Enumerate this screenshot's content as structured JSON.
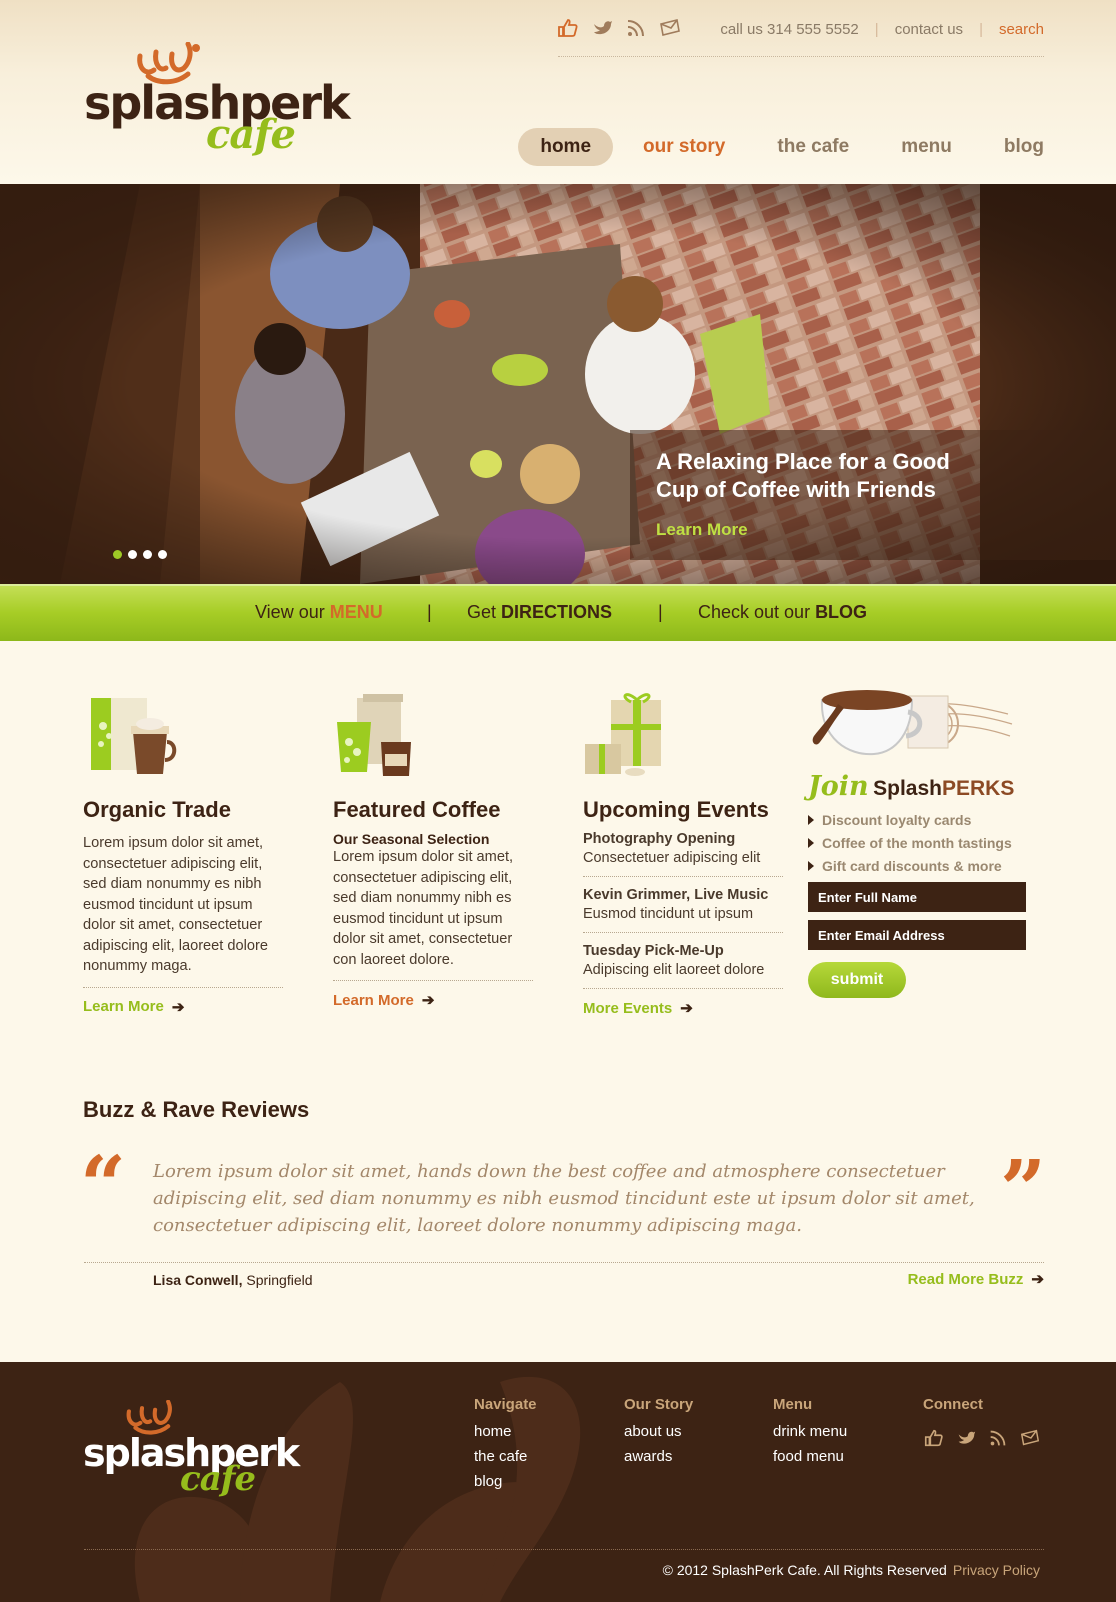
{
  "brand": {
    "name_main": "splashperk",
    "name_sub": "cafe"
  },
  "top_bar": {
    "icons": [
      "thumbs-up-icon",
      "bird-icon",
      "rss-icon",
      "mail-icon"
    ],
    "phone": "call us 314 555 5552",
    "contact": "contact us",
    "search": "search"
  },
  "nav": {
    "items": [
      {
        "label": "home",
        "active": true
      },
      {
        "label": "our story"
      },
      {
        "label": "the cafe"
      },
      {
        "label": "menu"
      },
      {
        "label": "blog"
      }
    ]
  },
  "hero": {
    "title": "A Relaxing Place for a Good Cup of Coffee with Friends",
    "learn_more": "Learn More",
    "slide_count": 4,
    "active_slide": 1
  },
  "green_bar": {
    "menu_prefix": "View our ",
    "menu_word": "MENU",
    "directions_prefix": "Get ",
    "directions_word": "DIRECTIONS",
    "blog_prefix": "Check out our ",
    "blog_word": "BLOG",
    "separator": "|"
  },
  "columns": {
    "organic": {
      "title": "Organic Trade",
      "text": "Lorem ipsum dolor sit amet, consectetuer adipiscing elit, sed diam nonummy es nibh eusmod tincidunt ut ipsum dolor sit amet, consectetuer adipiscing elit, laoreet dolore nonummy maga.",
      "link": "Learn More"
    },
    "featured": {
      "title": "Featured Coffee",
      "subtitle": "Our Seasonal Selection",
      "text": "Lorem ipsum dolor sit amet, consectetuer adipiscing elit, sed diam nonummy nibh es eusmod tincidunt ut ipsum dolor sit amet, consectetuer con laoreet dolore.",
      "link": "Learn More"
    },
    "events": {
      "title": "Upcoming Events",
      "items": [
        {
          "title": "Photography Opening",
          "desc": "Consectetuer adipiscing elit"
        },
        {
          "title": "Kevin Grimmer, Live Music",
          "desc": "Eusmod tincidunt ut ipsum"
        },
        {
          "title": "Tuesday Pick-Me-Up",
          "desc": "Adipiscing elit laoreet dolore"
        }
      ],
      "link": "More Events"
    }
  },
  "join": {
    "join_word": "Join",
    "splash_word": "Splash",
    "perks_word": "PERKS",
    "benefits": [
      "Discount loyalty cards",
      "Coffee of the month tastings",
      "Gift card discounts & more"
    ],
    "name_placeholder": "Enter Full Name",
    "email_placeholder": "Enter Email Address",
    "submit": "submit"
  },
  "buzz": {
    "title": "Buzz & Rave Reviews",
    "quote": "Lorem ipsum dolor sit amet, hands down the best coffee and atmosphere consectetuer adipiscing elit, sed diam nonummy es nibh eusmod tincidunt este ut ipsum dolor sit amet, consectetuer adipiscing elit, laoreet dolore nonummy adipiscing maga.",
    "author_name": "Lisa Conwell,",
    "author_city": "Springfield",
    "read_more": "Read More Buzz"
  },
  "footer": {
    "navigate": {
      "title": "Navigate",
      "links": [
        "home",
        "the cafe",
        "blog"
      ]
    },
    "our_story": {
      "title": "Our Story",
      "links": [
        "about us",
        "awards"
      ]
    },
    "menu": {
      "title": "Menu",
      "links": [
        "drink menu",
        "food menu"
      ]
    },
    "connect": {
      "title": "Connect",
      "icons": [
        "thumbs-up-icon",
        "bird-icon",
        "rss-icon",
        "mail-icon"
      ]
    },
    "copyright": "© 2012 SplashPerk Cafe. All Rights Reserved",
    "privacy": "Privacy Policy"
  },
  "colors": {
    "brown_dark": "#3d2314",
    "orange": "#d36a2a",
    "green": "#96bd1c",
    "cream": "#fdf8ea"
  }
}
